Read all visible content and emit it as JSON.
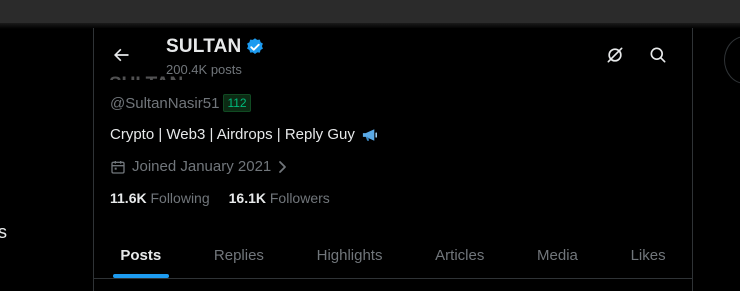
{
  "profile": {
    "display_name": "SULTAN",
    "posts_count": "200.4K posts",
    "handle": "@SultanNasir51",
    "badge": "112",
    "bio": "Crypto | Web3 | Airdrops | Reply Guy",
    "joined": "Joined January 2021",
    "following_count": "11.6K",
    "following_label": "Following",
    "followers_count": "16.1K",
    "followers_label": "Followers"
  },
  "tabs": [
    {
      "label": "Posts",
      "active": true
    },
    {
      "label": "Replies",
      "active": false
    },
    {
      "label": "Highlights",
      "active": false
    },
    {
      "label": "Articles",
      "active": false
    },
    {
      "label": "Media",
      "active": false
    },
    {
      "label": "Likes",
      "active": false
    }
  ],
  "left_edge_text": "s",
  "icons": {
    "back": "back-arrow-icon",
    "verified": "verified-badge-icon",
    "grok": "grok-icon",
    "search": "search-icon",
    "calendar": "calendar-icon",
    "megaphone": "megaphone-icon",
    "chevron": "chevron-right-icon"
  },
  "colors": {
    "background": "#000000",
    "accent": "#1d9bf0",
    "muted_text": "#71767b",
    "badge_green": "#00ba7c"
  }
}
